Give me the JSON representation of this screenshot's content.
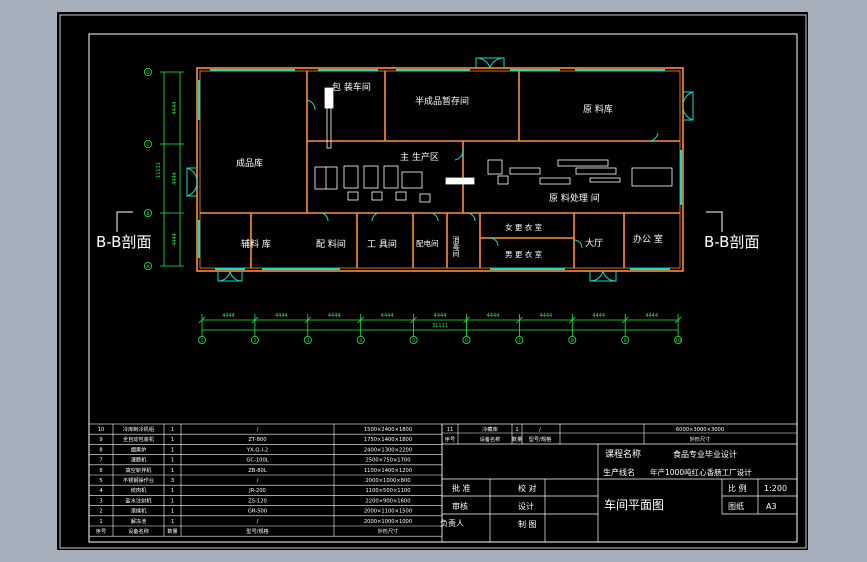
{
  "colors": {
    "background": "#a6b0bd",
    "paper": "#000000",
    "frame": "#ffffff",
    "wall": "#ff8c3a",
    "window": "#19d9c8",
    "dim": "#22ee44",
    "text": "#ffffff"
  },
  "rooms": {
    "finished": "成品库",
    "packing": "包 装车间",
    "semi": "半成品暂存间",
    "raw": "原 料库",
    "main": "主 生产区",
    "process": "原 料处理 间",
    "aux": "辅料 库",
    "ingredient": "配 料间",
    "tool": "工 具间",
    "power": "配电间",
    "disinfect": "消毒间",
    "female": "女 更 衣 室",
    "male": "男 更 衣 室",
    "hall": "大厅",
    "office": "办公 室"
  },
  "section_label": "B-B剖面",
  "dims": {
    "bay": "4444",
    "total": "31111",
    "vertical": "11111",
    "col_labels": [
      "1",
      "2",
      "3",
      "4",
      "5",
      "6",
      "7",
      "8",
      "9",
      "10"
    ],
    "row_labels": [
      "D",
      "C",
      "B",
      "A"
    ]
  },
  "title_block": {
    "course_label": "课程名称",
    "course_value": "食品专业毕业设计",
    "line_label": "生产线名",
    "line_value": "年产1000吨红心香肠工厂设计",
    "approve": "批 准",
    "proof": "校 对",
    "review": "审核",
    "design": "设计",
    "lead": "负责人",
    "draw": "制 图",
    "drawing_name": "车间平面图",
    "scale_label": "比 例",
    "scale_value": "1:200",
    "sheet_label": "图纸",
    "sheet_value": "A3"
  },
  "equipment_table": {
    "header": [
      "序号",
      "设备名称",
      "数量",
      "型号/规格",
      "外形尺寸"
    ],
    "rows": [
      [
        "10",
        "冷库制冷机组",
        "1",
        "/",
        "1500×2400×1800"
      ],
      [
        "9",
        "全自动包装机",
        "1",
        "ZT-800",
        "1750×1400×1800"
      ],
      [
        "8",
        "烟熏炉",
        "1",
        "YX-Q-I-2",
        "2400×1300×2200"
      ],
      [
        "7",
        "灌肠机",
        "1",
        "GC-100L",
        "2500×750×1700"
      ],
      [
        "6",
        "真空斩拌机",
        "1",
        "ZB-80L",
        "1100×1400×1200"
      ],
      [
        "5",
        "不锈钢操作台",
        "3",
        "/",
        "2000×1000×800"
      ],
      [
        "4",
        "绞肉机",
        "1",
        "JR-200",
        "1100×500×1100"
      ],
      [
        "3",
        "盐水注射机",
        "1",
        "ZS-120",
        "2200×900×1600"
      ],
      [
        "2",
        "滚揉机",
        "1",
        "GR-500",
        "2000×1100×1500"
      ],
      [
        "1",
        "解冻池",
        "1",
        "/",
        "2000×1000×1000"
      ]
    ],
    "top_header": [
      "序号",
      "设备名称",
      "数量",
      "型号/规格",
      "外形尺寸"
    ],
    "top_row": [
      "11",
      "冷藏库",
      "1",
      "/",
      "6000×3000×3000"
    ]
  }
}
